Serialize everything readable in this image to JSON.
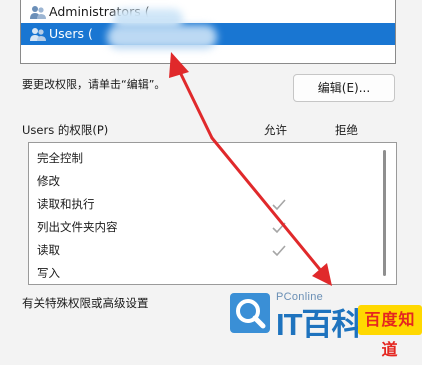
{
  "groups": [
    {
      "name": "Administrators (",
      "selected": false
    },
    {
      "name": "Users (",
      "selected": true
    }
  ],
  "change_hint": "要更改权限，请单击“编辑”。",
  "edit_button": "编辑(E)...",
  "permissions": {
    "title": "Users 的权限(P)",
    "allow_header": "允许",
    "deny_header": "拒绝",
    "rows": [
      {
        "label": "完全控制",
        "allow": false,
        "deny": false
      },
      {
        "label": "修改",
        "allow": false,
        "deny": false
      },
      {
        "label": "读取和执行",
        "allow": true,
        "deny": false
      },
      {
        "label": "列出文件夹内容",
        "allow": true,
        "deny": false
      },
      {
        "label": "读取",
        "allow": true,
        "deny": false
      },
      {
        "label": "写入",
        "allow": false,
        "deny": false
      }
    ]
  },
  "special_hint": "有关特殊权限或高级设置",
  "watermark": {
    "site": "PConline",
    "brand": "IT百科",
    "badge": "百度知道"
  },
  "colors": {
    "selection": "#1976d2",
    "annotation_arrow": "#e0292b",
    "check": "#a6a6a6"
  },
  "icons": [
    "users-group-icon",
    "check-icon"
  ]
}
